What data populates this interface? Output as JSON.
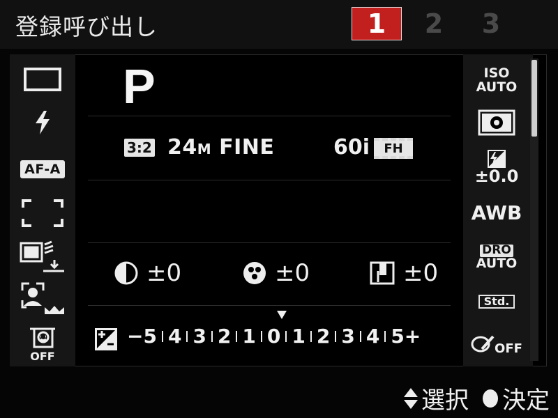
{
  "header": {
    "title": "登録呼び出し",
    "tabs": [
      {
        "label": "1",
        "active": true
      },
      {
        "label": "2",
        "active": false
      },
      {
        "label": "3",
        "active": false
      }
    ],
    "accent_color": "#c21f1f"
  },
  "left_column": {
    "items": [
      {
        "icon": "drive-mode-single-icon"
      },
      {
        "icon": "flash-icon"
      },
      {
        "icon": "af-mode-badge",
        "label": "AF-A"
      },
      {
        "icon": "focus-area-wide-icon"
      },
      {
        "icon": "face-registration-icon"
      },
      {
        "icon": "smile-shutter-icon"
      },
      {
        "icon": "soft-skin-icon",
        "label": "OFF"
      }
    ]
  },
  "center": {
    "shooting_mode": "P",
    "aspect_ratio": "3:2",
    "image_size": "24",
    "image_size_unit": "M",
    "quality": "FINE",
    "movie_rate": "60i",
    "movie_format": "FH",
    "contrast": {
      "icon": "contrast-icon",
      "value": "±0"
    },
    "saturation": {
      "icon": "saturation-icon",
      "value": "±0"
    },
    "sharpness": {
      "icon": "sharpness-icon",
      "value": "±0"
    },
    "exposure_scale": {
      "icon": "exposure-compensation-icon",
      "start": "−5",
      "end": "5+",
      "labels": [
        "4",
        "3",
        "2",
        "1",
        "0",
        "1",
        "2",
        "3",
        "4"
      ],
      "current": 0
    }
  },
  "right_column": {
    "iso": [
      "ISO",
      "AUTO"
    ],
    "metering_icon": "metering-multi-icon",
    "flash_comp": "±0.0",
    "white_balance": "AWB",
    "dro": [
      "DRO",
      "AUTO"
    ],
    "creative_style": "Std.",
    "picture_effect": "OFF"
  },
  "footer": {
    "select_label": "選択",
    "ok_label": "決定"
  }
}
